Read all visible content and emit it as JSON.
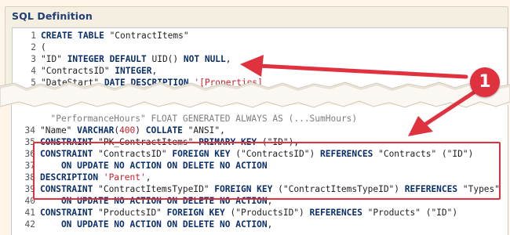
{
  "panel": {
    "title": "SQL Definition"
  },
  "code_top": [
    {
      "n": "1",
      "parts": [
        {
          "t": "CREATE TABLE ",
          "c": "kw"
        },
        {
          "t": "\"ContractItems\"",
          "c": "str"
        }
      ]
    },
    {
      "n": "2",
      "parts": [
        {
          "t": "(",
          "c": "str"
        }
      ]
    },
    {
      "n": "3",
      "parts": [
        {
          "t": "\"ID\" ",
          "c": "str"
        },
        {
          "t": "INTEGER DEFAULT ",
          "c": "kw"
        },
        {
          "t": "UID() ",
          "c": "str"
        },
        {
          "t": "NOT NULL",
          "c": "kw"
        },
        {
          "t": ",",
          "c": "str"
        }
      ]
    },
    {
      "n": "4",
      "parts": [
        {
          "t": "\"ContractsID\" ",
          "c": "str"
        },
        {
          "t": "INTEGER",
          "c": "kw"
        },
        {
          "t": ",",
          "c": "str"
        }
      ]
    },
    {
      "n": "5",
      "parts": [
        {
          "t": "\"DateStart\" ",
          "c": "str"
        },
        {
          "t": "DATE ",
          "c": "kw"
        },
        {
          "t": "DESCRIPTION ",
          "c": "kw"
        },
        {
          "t": "'[Properties]",
          "c": "red"
        }
      ]
    }
  ],
  "code_bottom": [
    {
      "n": "",
      "parts": [
        {
          "t": "  \"PerformanceHours\" ",
          "c": "faded"
        },
        {
          "t": "FLOAT GENERATED ALWAYS AS ",
          "c": "faded"
        },
        {
          "t": "(",
          "c": "faded"
        },
        {
          "t": "...SumHours",
          "c": "faded"
        },
        {
          "t": ")",
          "c": "faded"
        }
      ]
    },
    {
      "n": "34",
      "parts": [
        {
          "t": "\"Name\" ",
          "c": "str"
        },
        {
          "t": "VARCHAR",
          "c": "kw"
        },
        {
          "t": "(",
          "c": "str"
        },
        {
          "t": "400",
          "c": "num"
        },
        {
          "t": ") ",
          "c": "str"
        },
        {
          "t": "COLLATE ",
          "c": "kw"
        },
        {
          "t": "\"ANSI\",",
          "c": "str"
        }
      ]
    },
    {
      "n": "35",
      "parts": [
        {
          "t": "CONSTRAINT ",
          "c": "kw"
        },
        {
          "t": "\"PK_ContractItems\" ",
          "c": "str"
        },
        {
          "t": "PRIMARY KEY ",
          "c": "kw"
        },
        {
          "t": "(\"ID\"),",
          "c": "str"
        }
      ]
    },
    {
      "n": "36",
      "parts": [
        {
          "t": "CONSTRAINT ",
          "c": "kw"
        },
        {
          "t": "\"ContractsID\" ",
          "c": "str"
        },
        {
          "t": "FOREIGN KEY ",
          "c": "kw"
        },
        {
          "t": "(\"ContractsID\") ",
          "c": "str"
        },
        {
          "t": "REFERENCES ",
          "c": "kw"
        },
        {
          "t": "\"Contracts\" (\"ID\")",
          "c": "str"
        }
      ]
    },
    {
      "n": "37",
      "parts": [
        {
          "t": "    ON UPDATE NO ACTION ON DELETE NO ACTION",
          "c": "kw"
        }
      ]
    },
    {
      "n": "38",
      "parts": [
        {
          "t": "DESCRIPTION ",
          "c": "kw"
        },
        {
          "t": "'Parent'",
          "c": "red"
        },
        {
          "t": ",",
          "c": "str"
        }
      ]
    },
    {
      "n": "39",
      "parts": [
        {
          "t": "CONSTRAINT ",
          "c": "kw"
        },
        {
          "t": "\"ContractItemsTypeID\" ",
          "c": "str"
        },
        {
          "t": "FOREIGN KEY ",
          "c": "kw"
        },
        {
          "t": "(\"ContractItemsTypeID\") ",
          "c": "str"
        },
        {
          "t": "REFERENCES ",
          "c": "kw"
        },
        {
          "t": "\"Types\"",
          "c": "str"
        }
      ]
    },
    {
      "n": "40",
      "parts": [
        {
          "t": "    ON UPDATE NO ACTION ON DELETE NO ACTION",
          "c": "kw"
        },
        {
          "t": ",",
          "c": "str"
        }
      ]
    },
    {
      "n": "41",
      "parts": [
        {
          "t": "CONSTRAINT ",
          "c": "kw"
        },
        {
          "t": "\"ProductsID\" ",
          "c": "str"
        },
        {
          "t": "FOREIGN KEY ",
          "c": "kw"
        },
        {
          "t": "(\"ProductsID\") ",
          "c": "str"
        },
        {
          "t": "REFERENCES ",
          "c": "kw"
        },
        {
          "t": "\"Products\" (\"ID\")",
          "c": "str"
        }
      ]
    },
    {
      "n": "42",
      "parts": [
        {
          "t": "    ON UPDATE NO ACTION ON DELETE NO ACTION",
          "c": "kw"
        },
        {
          "t": ",",
          "c": "str"
        }
      ]
    }
  ],
  "annotation": {
    "badge_number": "1",
    "color": "#e0313f",
    "highlighted_lines": [
      "35",
      "36",
      "37",
      "38",
      "39"
    ]
  },
  "colors": {
    "keyword": "#0b2f6b",
    "string_literal": "#c8202a",
    "panel_title": "#1f3f76",
    "background": "#fff5e8"
  }
}
